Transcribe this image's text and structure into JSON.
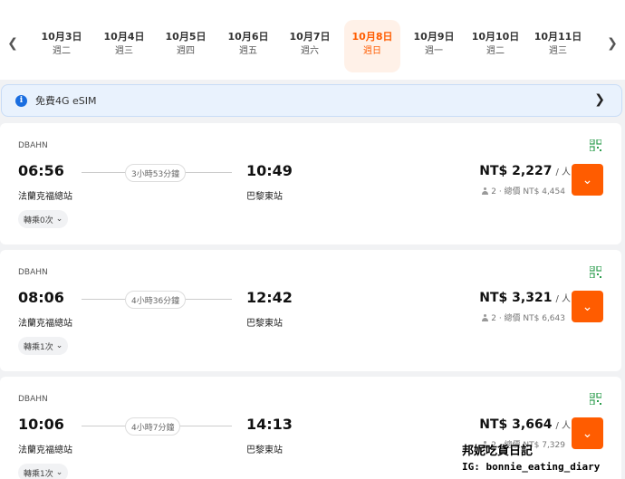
{
  "date_bar": {
    "prev_icon": "chevron-left-icon",
    "next_icon": "chevron-right-icon",
    "dates": [
      {
        "date": "10月3日",
        "weekday": "週二",
        "active": false
      },
      {
        "date": "10月4日",
        "weekday": "週三",
        "active": false
      },
      {
        "date": "10月5日",
        "weekday": "週四",
        "active": false
      },
      {
        "date": "10月6日",
        "weekday": "週五",
        "active": false
      },
      {
        "date": "10月7日",
        "weekday": "週六",
        "active": false
      },
      {
        "date": "10月8日",
        "weekday": "週日",
        "active": true
      },
      {
        "date": "10月9日",
        "weekday": "週一",
        "active": false
      },
      {
        "date": "10月10日",
        "weekday": "週二",
        "active": false
      },
      {
        "date": "10月11日",
        "weekday": "週三",
        "active": false
      }
    ]
  },
  "esim_banner": {
    "label": "免費4G eSIM",
    "info_icon_text": "i"
  },
  "results": [
    {
      "operator": "DBAHN",
      "depart_time": "06:56",
      "arrive_time": "10:49",
      "duration": "3小時53分鐘",
      "depart_station": "法蘭克福總站",
      "arrive_station": "巴黎東站",
      "transfers": "轉乘0次",
      "price": "NT$ 2,227",
      "per_person": "/ 人",
      "passengers": "2 · 總價 NT$ 4,454"
    },
    {
      "operator": "DBAHN",
      "depart_time": "08:06",
      "arrive_time": "12:42",
      "duration": "4小時36分鐘",
      "depart_station": "法蘭克福總站",
      "arrive_station": "巴黎東站",
      "transfers": "轉乘1次",
      "price": "NT$ 3,321",
      "per_person": "/ 人",
      "passengers": "2 · 總價 NT$ 6,643"
    },
    {
      "operator": "DBAHN",
      "depart_time": "10:06",
      "arrive_time": "14:13",
      "duration": "4小時7分鐘",
      "depart_station": "法蘭克福總站",
      "arrive_station": "巴黎東站",
      "transfers": "轉乘1次",
      "price": "NT$ 3,664",
      "per_person": "/ 人",
      "passengers": "2 · 總價 NT$ 7,329"
    }
  ],
  "watermark": {
    "line1": "邦妮吃貨日記",
    "line2": "IG: bonnie_eating_diary"
  },
  "colors": {
    "accent": "#ff5c00",
    "active_date_bg": "#fff1e8",
    "banner_bg": "#e9f2fd",
    "qr_green": "#2e9e4f"
  }
}
